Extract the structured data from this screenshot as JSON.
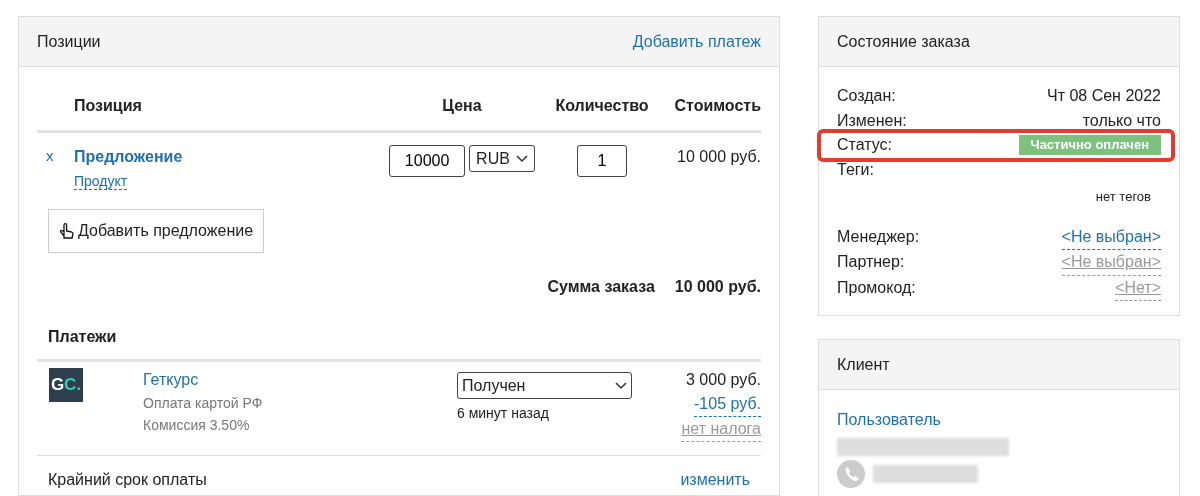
{
  "positions_card": {
    "title": "Позиции",
    "action": "Добавить платеж",
    "columns": [
      "Позиция",
      "Цена",
      "Количество",
      "Стоимость"
    ],
    "items": [
      {
        "remove": "x",
        "name": "Предложение",
        "type": "Продукт",
        "price": "10000",
        "currency": "RUB",
        "quantity": "1",
        "cost": "10 000 руб."
      }
    ],
    "add_button": "Добавить предложение",
    "total_label": "Сумма заказа",
    "total": "10 000 руб.",
    "payments_title": "Платежи",
    "payments": [
      {
        "logo_main": "G",
        "logo_accent": "C.",
        "provider": "Геткурс",
        "method": "Оплата картой РФ",
        "commission": "Комиссия 3.50%",
        "status": "Получен",
        "time": "6 минут назад",
        "amount": "3 000 руб.",
        "fee": "-105 руб.",
        "tax": "нет налога"
      }
    ],
    "deadline_label": "Крайний срок оплаты",
    "deadline_action": "изменить"
  },
  "order_state": {
    "title": "Состояние заказа",
    "fields": [
      {
        "kind": "text",
        "label": "Создан:",
        "value": "Чт 08 Сен 2022"
      },
      {
        "kind": "text",
        "label": "Изменен:",
        "value": "только что"
      },
      {
        "kind": "badge",
        "label": "Статус:",
        "value": "Частично оплачен",
        "color": "#7dc17f",
        "highlighted": true
      },
      {
        "kind": "tags",
        "label": "Теги:",
        "value": "нет тегов"
      },
      {
        "kind": "link",
        "label": "Менеджер:",
        "value": "<Не выбран>"
      },
      {
        "kind": "muted-link",
        "label": "Партнер:",
        "value": "<Не выбран>"
      },
      {
        "kind": "muted-link",
        "label": "Промокод:",
        "value": "<Нет>"
      }
    ]
  },
  "client": {
    "title": "Клиент",
    "user_link": "Пользователь"
  }
}
